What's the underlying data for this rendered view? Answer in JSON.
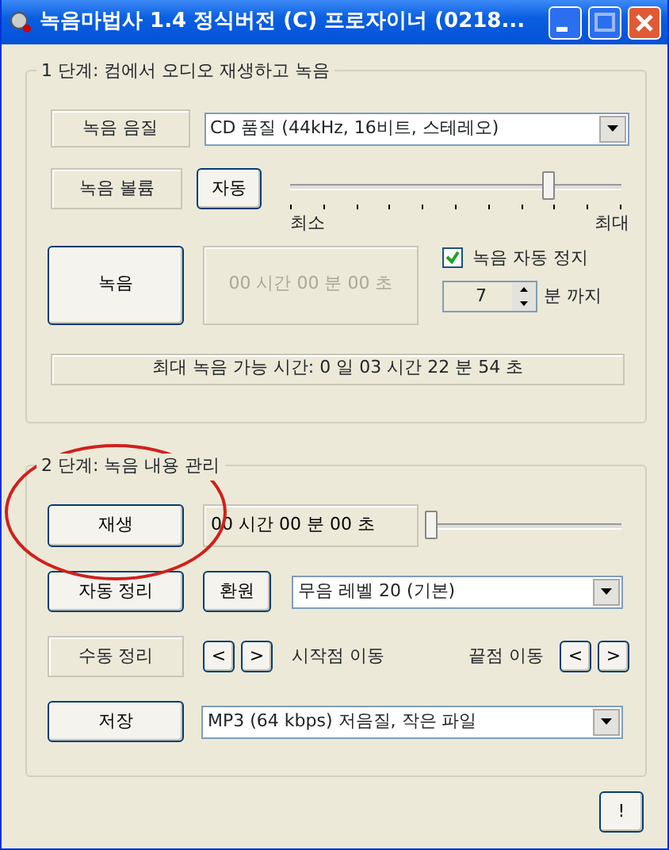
{
  "window": {
    "title": "녹음마법사 1.4 정식버전 (C) 프로자이너 (0218..."
  },
  "step1": {
    "title": "1 단계:  컴에서 오디오 재생하고 녹음",
    "quality": {
      "label": "녹음 음질",
      "value": "CD 품질 (44kHz, 16비트, 스테레오)"
    },
    "volume": {
      "label": "녹음 볼륨",
      "auto_button": "자동",
      "level": 0.78,
      "min_label": "최소",
      "max_label": "최대"
    },
    "record": {
      "button": "녹음",
      "time": "00 시간 00 분 00 초",
      "time_disabled": true,
      "auto_stop": {
        "label": "녹음 자동 정지",
        "checked": true
      },
      "minutes": "7",
      "minutes_label": "분 까지"
    },
    "status": "최대 녹음 가능 시간:  0 일 03 시간 22 분 54 초"
  },
  "step2": {
    "title": "2 단계:  녹음 내용 관리",
    "play": {
      "button": "재생",
      "circled": true,
      "time": "00 시간 00 분 00 초",
      "time_disabled": false,
      "level": 0
    },
    "auto_trim": {
      "button": "자동 정리",
      "restore_button": "환원",
      "value": "무음 레벨 20 (기본)"
    },
    "manual_trim": {
      "label": "수동 정리",
      "start_prev": "<",
      "start_next": ">",
      "start_label": "시작점 이동",
      "end_label": "끝점 이동",
      "end_prev": "<",
      "end_next": ">"
    },
    "save": {
      "button": "저장",
      "value": "MP3 (64 kbps) 저음질, 작은 파일"
    }
  },
  "info_button": "!"
}
